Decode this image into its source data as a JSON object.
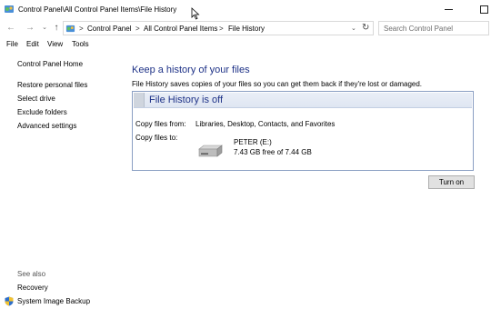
{
  "window": {
    "title": "Control Panel\\All Control Panel Items\\File History",
    "icon": "control-panel-icon"
  },
  "address": {
    "crumbs": [
      "Control Panel",
      "All Control Panel Items",
      "File History"
    ],
    "separator": ">",
    "search_placeholder": "Search Control Panel"
  },
  "menu": [
    "File",
    "Edit",
    "View",
    "Tools"
  ],
  "sidebar": {
    "home": "Control Panel Home",
    "links": [
      "Restore personal files",
      "Select drive",
      "Exclude folders",
      "Advanced settings"
    ],
    "see_also_label": "See also",
    "see_also": [
      "Recovery",
      "System Image Backup"
    ]
  },
  "main": {
    "heading": "Keep a history of your files",
    "description": "File History saves copies of your files so you can get them back if they're lost or damaged.",
    "status_title": "File History is off",
    "copy_from_label": "Copy files from:",
    "copy_from_value": "Libraries, Desktop, Contacts, and Favorites",
    "copy_to_label": "Copy files to:",
    "drive_name": "PETER (E:)",
    "drive_space": "7.43 GB free of 7.44 GB",
    "turn_on_label": "Turn on"
  },
  "colors": {
    "heading": "#1e3287",
    "panel_border": "#8a9fc3"
  }
}
